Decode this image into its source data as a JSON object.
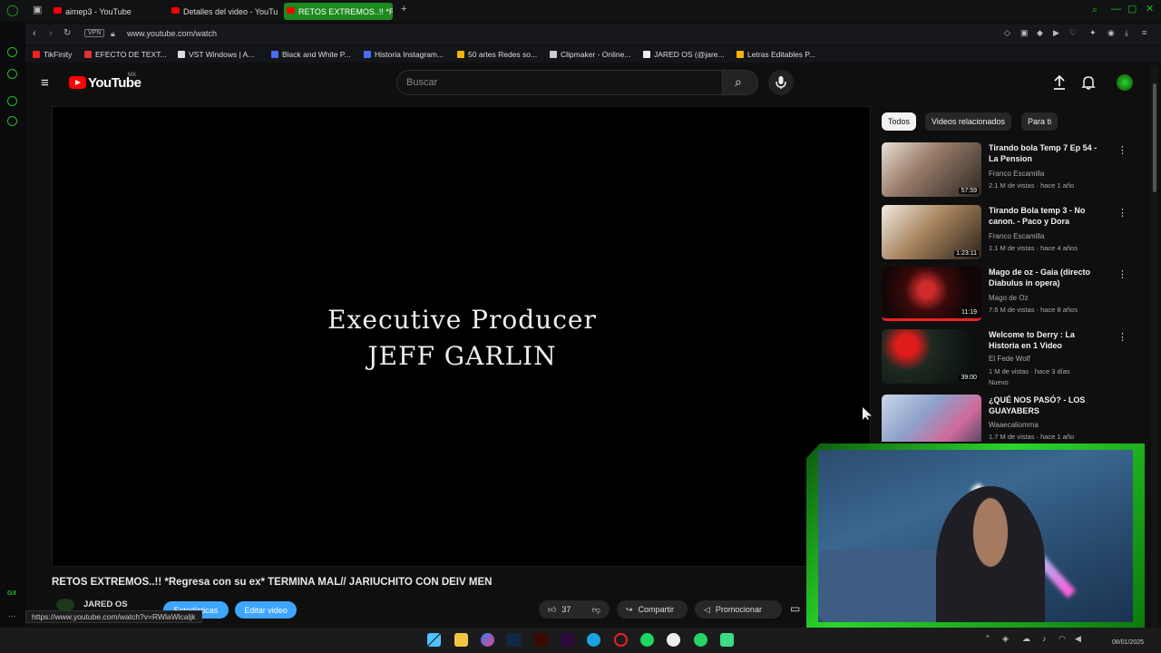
{
  "browser": {
    "tabs": [
      {
        "label": "aimep3 - YouTube"
      },
      {
        "label": "Detalles del video - YouTu"
      },
      {
        "label": "RETOS EXTREMOS..!! *Re"
      }
    ],
    "vpn_label": "VPN",
    "url": "www.youtube.com/watch",
    "bookmarks": [
      {
        "label": "TikFinity"
      },
      {
        "label": "EFECTO DE TEXT..."
      },
      {
        "label": "VST Windows | A..."
      },
      {
        "label": "Black and White P..."
      },
      {
        "label": "Historia Instagram..."
      },
      {
        "label": "50 artes Redes so..."
      },
      {
        "label": "Clipmaker - Online..."
      },
      {
        "label": "JARED OS (@jare..."
      },
      {
        "label": "Letras Editables P..."
      }
    ],
    "status_url": "https://www.youtube.com/watch?v=RWlaWlcaljk",
    "gx_label": "GX"
  },
  "youtube": {
    "logo_text": "YouTube",
    "region": "MX",
    "search_placeholder": "Buscar",
    "player": {
      "line1": "Executive Producer",
      "line2": "JEFF GARLIN"
    },
    "video_title": "RETOS EXTREMOS..!! *Regresa con su ex* TERMINA MAL// JARIUCHITO CON DEIV MEN",
    "channel_name": "JARED OS",
    "btn_studio": "Estadísticas",
    "btn_edit": "Editar video",
    "likes": "37",
    "share_label": "Compartir",
    "promote_label": "Promocionar",
    "chips": [
      {
        "label": "Todos"
      },
      {
        "label": "Videos relacionados"
      },
      {
        "label": "Para ti"
      }
    ],
    "recommendations": [
      {
        "title": "Tirando bola Temp 7 Ep 54 - La Pension",
        "channel": "Franco Escamilla",
        "meta": "2.1 M de vistas · hace 1 año",
        "duration": "57:59"
      },
      {
        "title": "Tirando Bola temp 3 - No canon. - Paco y Dora",
        "channel": "Franco Escamilla",
        "meta": "1.1 M de vistas · hace 4 años",
        "duration": "1:23:11"
      },
      {
        "title": "Mago de oz - Gaia (directo Diabulus in opera)",
        "channel": "Mago de Oz",
        "meta": "7.6 M de vistas · hace 8 años",
        "duration": "11:19"
      },
      {
        "title": "Welcome to Derry : La Historia en 1 Video",
        "channel": "El Fede Wolf",
        "meta": "1 M de vistas · hace 3 días",
        "extra": "Nuevo",
        "duration": "39:00"
      },
      {
        "title": "¿QUÉ NOS PASÓ? - LOS GUAYABERS",
        "channel": "Waaecaliomma",
        "meta": "1.7 M de vistas · hace 1 año",
        "duration": ""
      }
    ]
  },
  "taskbar": {
    "date": "08/01/2025"
  },
  "colors": {
    "accent_green": "#1e8b1e",
    "yt_red": "#ff0000",
    "blue_button": "#3ea6ff"
  }
}
